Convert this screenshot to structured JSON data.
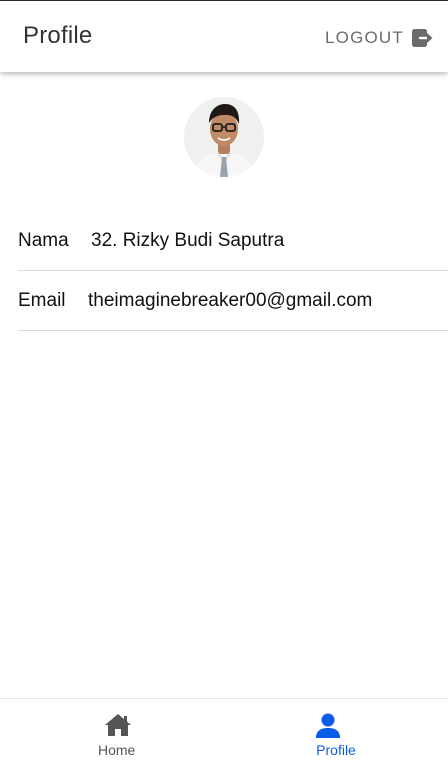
{
  "header": {
    "title": "Profile",
    "logout_label": "LOGOUT",
    "logout_icon": "logout-icon"
  },
  "profile": {
    "avatar_alt": "avatar",
    "fields": [
      {
        "label": "Nama",
        "value": "32. Rizky Budi Saputra"
      },
      {
        "label": "Email",
        "value": "theimaginebreaker00@gmail.com"
      }
    ]
  },
  "bottom_nav": {
    "items": [
      {
        "label": "Home",
        "icon": "home-icon",
        "active": false
      },
      {
        "label": "Profile",
        "icon": "person-icon",
        "active": true
      }
    ]
  },
  "colors": {
    "active": "#0a5ce6",
    "inactive": "#555555",
    "title_text": "#333333"
  }
}
